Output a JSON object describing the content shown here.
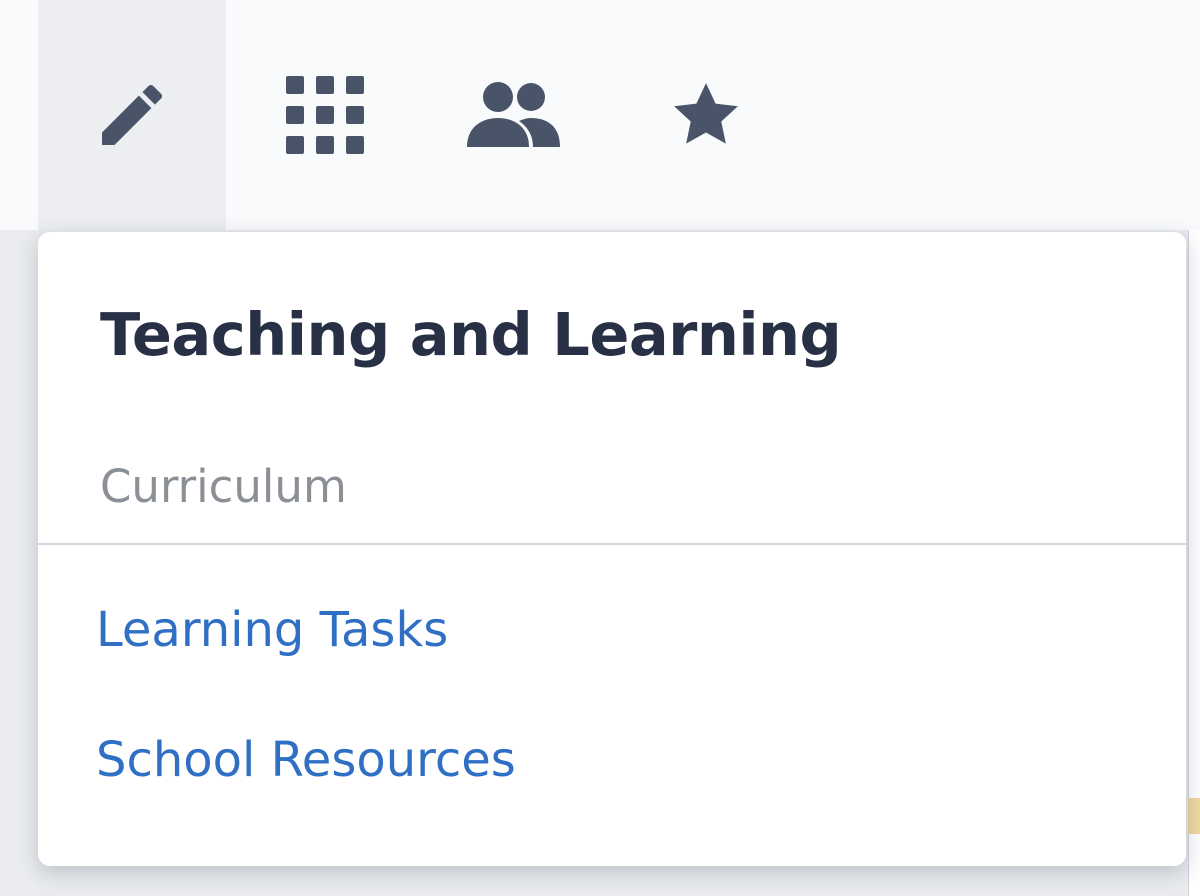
{
  "toolbar": {
    "items": [
      {
        "icon": "pencil-icon",
        "active": true
      },
      {
        "icon": "grid-icon",
        "active": false
      },
      {
        "icon": "people-icon",
        "active": false
      },
      {
        "icon": "star-icon",
        "active": false
      }
    ],
    "icon_color": "#4a5468",
    "active_background": "#eceef2"
  },
  "dropdown": {
    "title": "Teaching and Learning",
    "section_heading": "Curriculum",
    "links": [
      {
        "label": "Learning Tasks"
      },
      {
        "label": "School Resources"
      }
    ],
    "link_color": "#2f70c4"
  }
}
